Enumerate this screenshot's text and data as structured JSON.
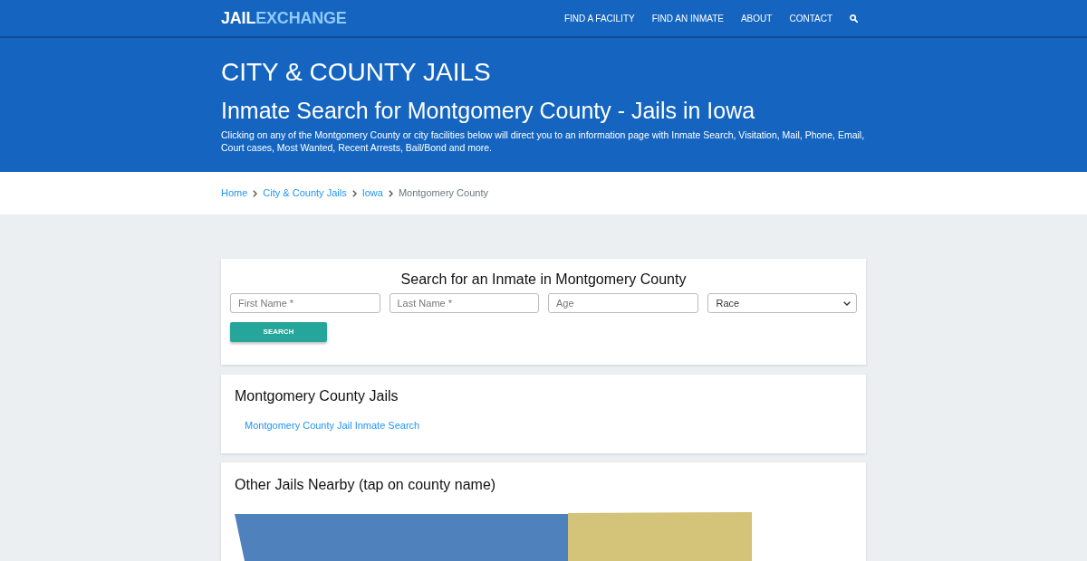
{
  "navbar": {
    "logo": {
      "lead": "JAIL",
      "accent": "EXCHANGE"
    },
    "links": [
      "FIND A FACILITY",
      "FIND AN INMATE",
      "ABOUT",
      "CONTACT"
    ]
  },
  "hero": {
    "kicker": "CITY & COUNTY JAILS",
    "title": "Inmate Search for Montgomery County - Jails in Iowa",
    "description": "Clicking on any of the Montgomery County or city facilities below will direct you to an information page with Inmate Search, Visitation, Mail, Phone, Email, Court cases, Most Wanted, Recent Arrests, Bail/Bond and more."
  },
  "breadcrumb": [
    {
      "label": "Home",
      "current": false
    },
    {
      "label": "City & County Jails",
      "current": false
    },
    {
      "label": "Iowa",
      "current": false
    },
    {
      "label": "Montgomery County",
      "current": true
    }
  ],
  "search_form": {
    "title": "Search for an Inmate in Montgomery County",
    "fields": [
      {
        "kind": "text",
        "placeholder": "First Name *"
      },
      {
        "kind": "text",
        "placeholder": "Last Name *"
      },
      {
        "kind": "text",
        "placeholder": "Age"
      },
      {
        "kind": "select",
        "value": "Race"
      }
    ],
    "button": "SEARCH"
  },
  "jails_card": {
    "title": "Montgomery County Jails",
    "links": [
      "Montgomery County Jail Inmate Search"
    ]
  },
  "nearby_card": {
    "title": "Other Jails Nearby (tap on county name)"
  }
}
